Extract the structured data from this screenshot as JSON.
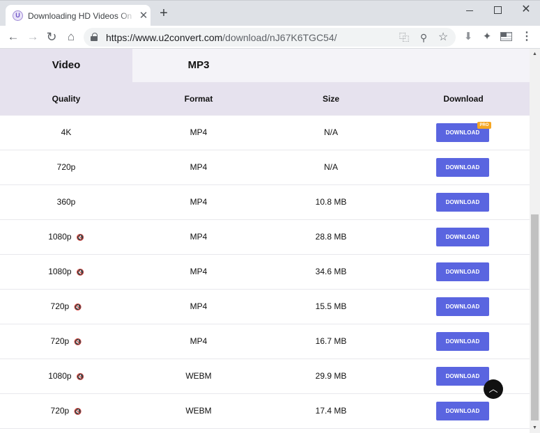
{
  "browser": {
    "tab_title": "Downloading HD Videos Online",
    "tab_favicon": "U",
    "new_tab_label": "+",
    "url_host": "https://www.u2convert.com",
    "url_path": "/download/nJ67K6TGC54/",
    "icons": {
      "back": "arrow-left-icon",
      "forward": "arrow-right-icon",
      "reload": "reload-icon",
      "home": "home-icon",
      "lock": "lock-icon",
      "translate": "translate-icon",
      "zoom": "zoom-icon",
      "star": "star-icon",
      "download": "download-icon",
      "extensions": "puzzle-icon",
      "menu": "kebab-menu-icon"
    }
  },
  "tabs": [
    {
      "label": "Video",
      "active": true
    },
    {
      "label": "MP3",
      "active": false
    }
  ],
  "table": {
    "headers": [
      "Quality",
      "Format",
      "Size",
      "Download"
    ],
    "rows": [
      {
        "quality": "4K",
        "muted": false,
        "format": "MP4",
        "size": "N/A",
        "button": "DOWNLOAD",
        "badge": "PRO"
      },
      {
        "quality": "720p",
        "muted": false,
        "format": "MP4",
        "size": "N/A",
        "button": "DOWNLOAD"
      },
      {
        "quality": "360p",
        "muted": false,
        "format": "MP4",
        "size": "10.8 MB",
        "button": "DOWNLOAD"
      },
      {
        "quality": "1080p",
        "muted": true,
        "format": "MP4",
        "size": "28.8 MB",
        "button": "DOWNLOAD"
      },
      {
        "quality": "1080p",
        "muted": true,
        "format": "MP4",
        "size": "34.6 MB",
        "button": "DOWNLOAD"
      },
      {
        "quality": "720p",
        "muted": true,
        "format": "MP4",
        "size": "15.5 MB",
        "button": "DOWNLOAD"
      },
      {
        "quality": "720p",
        "muted": true,
        "format": "MP4",
        "size": "16.7 MB",
        "button": "DOWNLOAD"
      },
      {
        "quality": "1080p",
        "muted": true,
        "format": "WEBM",
        "size": "29.9 MB",
        "button": "DOWNLOAD"
      },
      {
        "quality": "720p",
        "muted": true,
        "format": "WEBM",
        "size": "17.4 MB",
        "button": "DOWNLOAD"
      }
    ]
  },
  "colors": {
    "download_button": "#5a65e0",
    "pro_badge": "#f5a623",
    "header_bg": "#e6e2ee",
    "tab_bg": "#f4f3f8"
  }
}
